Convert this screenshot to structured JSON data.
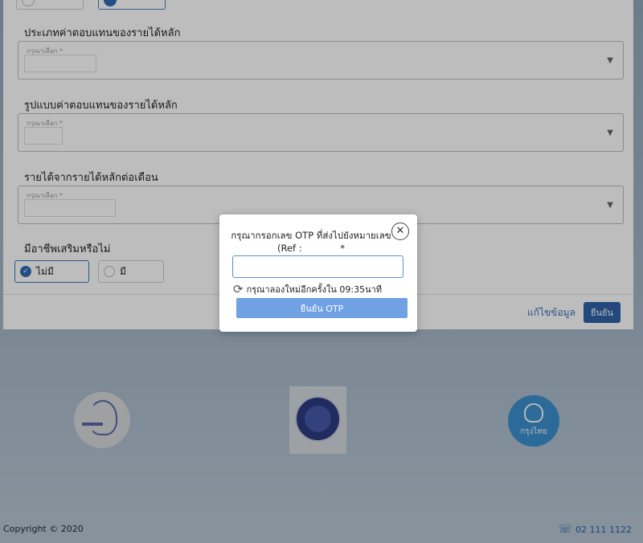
{
  "form": {
    "sections": [
      {
        "label": "ประเภทค่าตอบแทนของรายได้หลัก",
        "hint": "กรุณาเลือก *"
      },
      {
        "label": "รูปแบบค่าตอบแทนของรายได้หลัก",
        "hint": "กรุณาเลือก *"
      },
      {
        "label": "รายได้จากรายได้หลักต่อเดือน",
        "hint": "กรุณาเลือก *"
      }
    ],
    "side_job_label": "มีอาชีพเสริมหรือไม่",
    "options": [
      {
        "label": "ไม่มี",
        "selected": true
      },
      {
        "label": "มี",
        "selected": false
      }
    ],
    "edit_link": "แก้ไขข้อมูล",
    "confirm_button": "ยืนยัน"
  },
  "modal": {
    "title_line1": "กรุณากรอกเลข OTP ที่ส่งไปยังหมายเลข",
    "title_line2": "(Ref :",
    "title_line2_end": "*",
    "close_symbol": "✕",
    "otp_value": "",
    "retry_text": "กรุณาลองใหม่อีกครั้งใน 09:35นาที",
    "retry_icon": "refresh-icon",
    "confirm_otp_button": "ยืนยัน OTP"
  },
  "footer": {
    "copyright": "Copyright © 2020",
    "phone": "02 111 1122",
    "phone_icon": "phone-icon"
  },
  "logos": {
    "ktb_text": "กรุงไทย"
  },
  "colors": {
    "primary": "#2f62a8",
    "otp_button": "#6fa1e3"
  }
}
